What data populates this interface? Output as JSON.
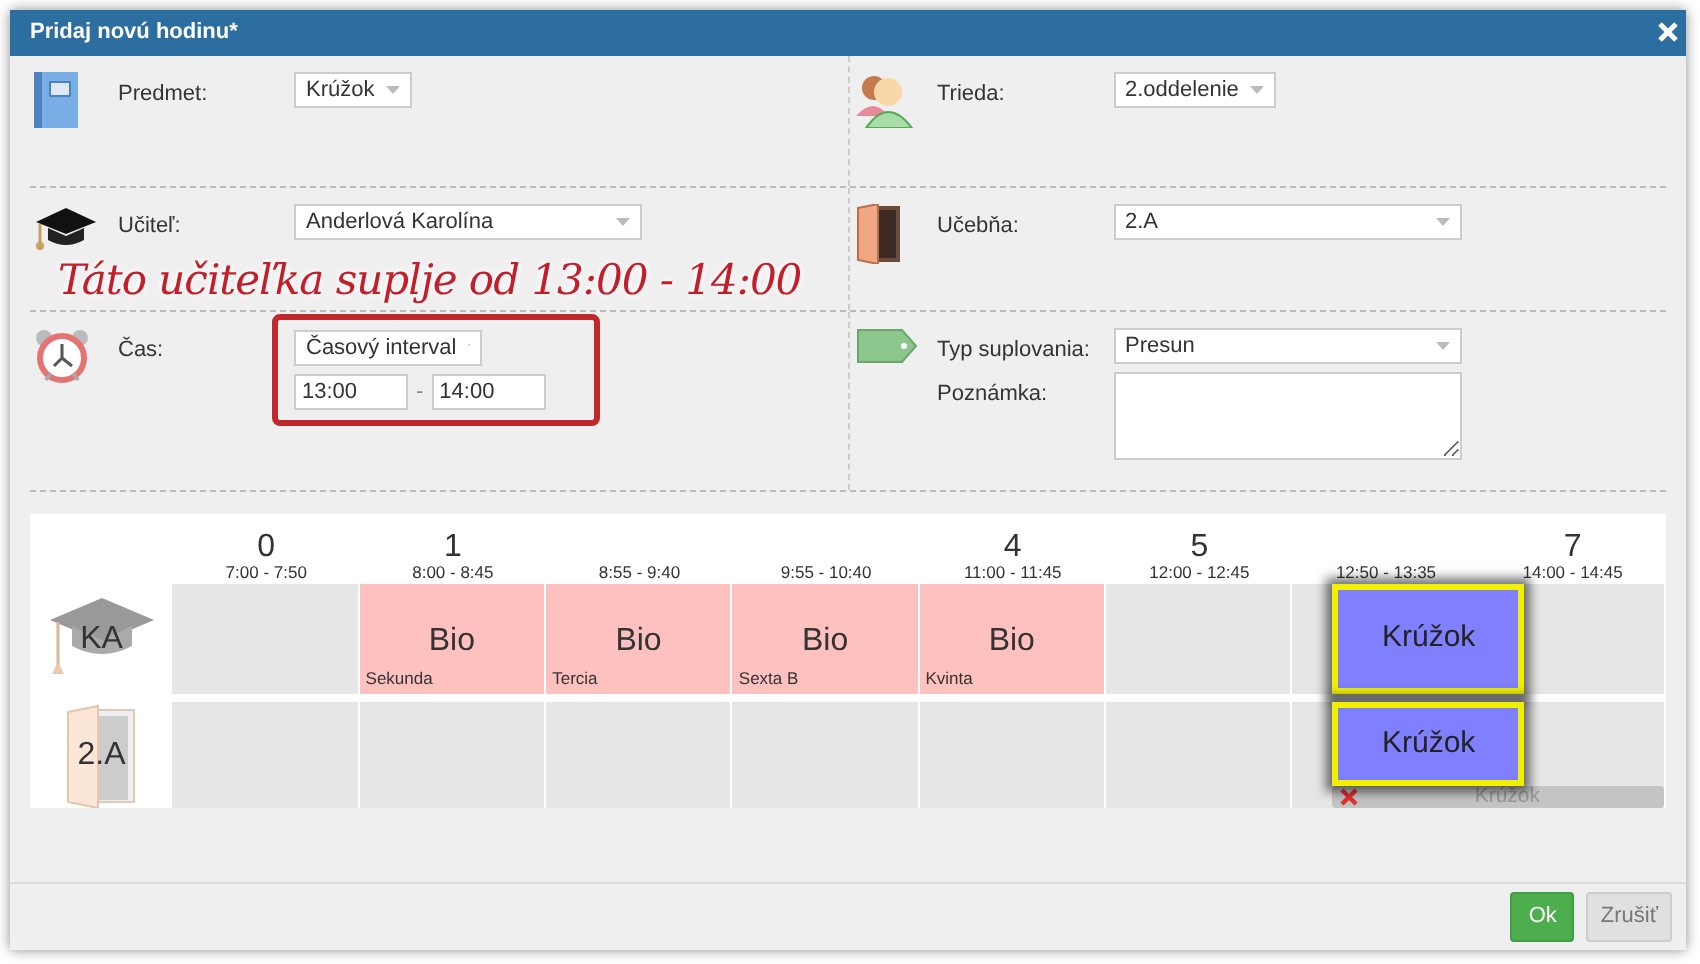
{
  "dialog": {
    "title": "Pridaj novú hodinu*"
  },
  "form_rows": [
    [
      {
        "label": "Predmet:",
        "kind": "select",
        "value": "Krúžok"
      },
      {
        "label": "Trieda:",
        "kind": "select",
        "value": "2.oddelenie"
      }
    ],
    [
      {
        "label": "Učiteľ:",
        "kind": "select",
        "value": "Anderlová Karolína"
      },
      {
        "label": "Učebňa:",
        "kind": "select",
        "value": "2.A"
      }
    ],
    [
      {
        "label": "Čas:",
        "kind": "time",
        "value": "Časový interval",
        "from": "13:00",
        "separator": "-",
        "to": "14:00",
        "highlighted": true
      },
      {
        "label": "Typ suplovania:",
        "kind": "select_note",
        "value": "Presun",
        "note_label": "Poznámka:"
      }
    ]
  ],
  "annotation": {
    "text": "Táto učiteľka suplje od 13:00 - 14:00"
  },
  "timetable": {
    "periods": [
      {
        "number": "0",
        "time": "7:00 - 7:50"
      },
      {
        "number": "1",
        "time": "8:00 - 8:45"
      },
      {
        "time": "8:55 - 9:40"
      },
      {
        "time": "9:55 - 10:40"
      },
      {
        "number": "4",
        "time": "11:00 - 11:45"
      },
      {
        "number": "5",
        "time": "12:00 - 12:45"
      },
      {
        "time": "12:50 - 13:35"
      },
      {
        "number": "7",
        "time": "14:00 - 14:45"
      }
    ],
    "rows": [
      {
        "label": "KA",
        "cells": [
          {
            "kind": "empty"
          },
          {
            "kind": "lesson",
            "subject": "Bio",
            "group": "Sekunda"
          },
          {
            "kind": "lesson",
            "subject": "Bio",
            "group": "Tercia"
          },
          {
            "kind": "lesson",
            "subject": "Bio",
            "group": "Sexta B"
          },
          {
            "kind": "lesson",
            "subject": "Bio",
            "group": "Kvinta"
          },
          {
            "kind": "empty"
          },
          {
            "kind": "substitute",
            "subject": "Krúžok"
          },
          {
            "kind": "empty"
          }
        ]
      },
      {
        "label": "2.A",
        "cells": [
          {
            "kind": "empty"
          },
          {
            "kind": "empty"
          },
          {
            "kind": "empty"
          },
          {
            "kind": "empty"
          },
          {
            "kind": "empty"
          },
          {
            "kind": "empty"
          },
          {
            "kind": "substitute",
            "subject": "Krúžok",
            "cancelled": "Krúžok"
          },
          {
            "kind": "empty"
          }
        ]
      }
    ]
  },
  "buttons": [
    {
      "label": "Ok",
      "kind": "primary"
    },
    {
      "label": "Zrušiť",
      "kind": "secondary"
    }
  ]
}
